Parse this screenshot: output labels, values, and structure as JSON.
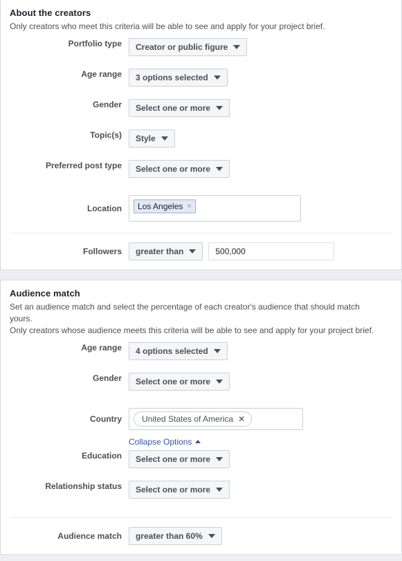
{
  "creators": {
    "title": "About the creators",
    "description": "Only creators who meet this criteria will be able to see and apply for your project brief.",
    "fields": {
      "portfolio_type": {
        "label": "Portfolio type",
        "value": "Creator or public figure"
      },
      "age_range": {
        "label": "Age range",
        "value": "3 options selected"
      },
      "gender": {
        "label": "Gender",
        "value": "Select one or more"
      },
      "topics": {
        "label": "Topic(s)",
        "value": "Style"
      },
      "preferred_post_type": {
        "label": "Preferred post type",
        "value": "Select one or more"
      },
      "location": {
        "label": "Location",
        "tags": [
          "Los Angeles"
        ],
        "remove_glyph": "×"
      },
      "followers": {
        "label": "Followers",
        "operator": "greater than",
        "value": "500,000"
      }
    }
  },
  "audience": {
    "title": "Audience match",
    "description_line1": "Set an audience match and select the percentage of each creator's audience that should match yours.",
    "description_line2": "Only creators whose audience meets this criteria will be able to see and apply for your project brief.",
    "fields": {
      "age_range": {
        "label": "Age range",
        "value": "4 options selected"
      },
      "gender": {
        "label": "Gender",
        "value": "Select one or more"
      },
      "country": {
        "label": "Country",
        "tags": [
          "United States of America"
        ],
        "remove_glyph": "✕"
      },
      "collapse": {
        "label": "Collapse Options"
      },
      "education": {
        "label": "Education",
        "value": "Select one or more"
      },
      "relationship_status": {
        "label": "Relationship status",
        "value": "Select one or more"
      },
      "audience_match": {
        "label": "Audience match",
        "value": "greater than 60%"
      }
    }
  },
  "colors": {
    "page_background": "#eceef1",
    "card_background": "#ffffff",
    "dropdown_background": "#f5f6f7",
    "dropdown_border": "#ccd0d5",
    "link": "#385898",
    "label_text": "#4b4f56",
    "title_text": "#1d2129",
    "token_blue_background": "#e2e9f4",
    "token_blue_border": "#9db0d4",
    "divider": "#e9ebee"
  }
}
